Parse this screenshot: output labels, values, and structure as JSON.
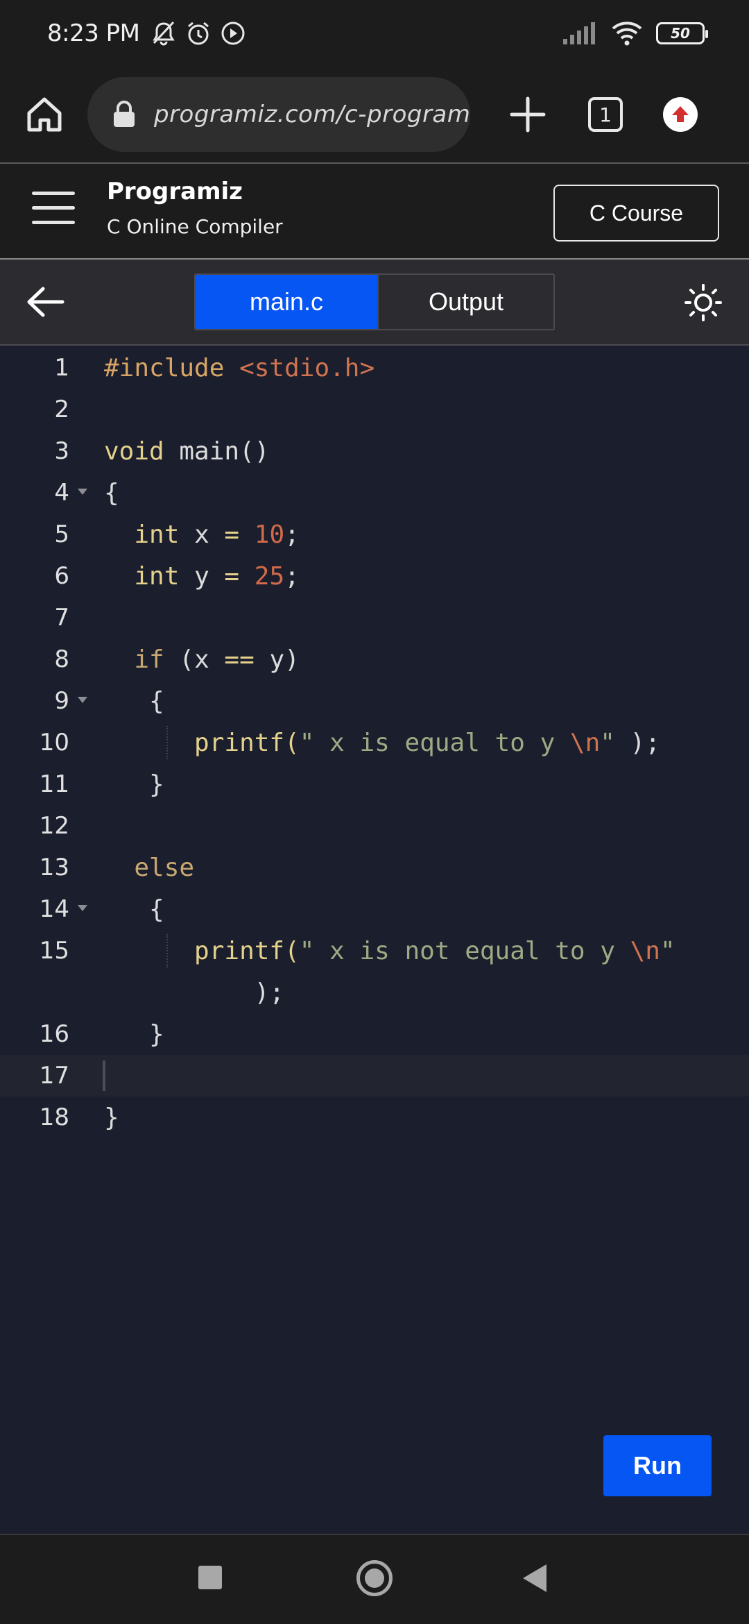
{
  "status_bar": {
    "time": "8:23 PM",
    "battery": "50",
    "icons": [
      "bell-off-icon",
      "alarm-icon",
      "play-circle-icon",
      "signal-icon",
      "wifi-icon",
      "battery-icon"
    ]
  },
  "browser": {
    "url": "programiz.com/c-programm",
    "tab_count": "1"
  },
  "site_header": {
    "brand": "Programiz",
    "subtitle": "C Online Compiler",
    "course_button": "C Course"
  },
  "editor_toolbar": {
    "tabs": [
      {
        "label": "main.c",
        "active": true
      },
      {
        "label": "Output",
        "active": false
      }
    ]
  },
  "code_lines": [
    {
      "no": "1",
      "text": "#include <stdio.h>"
    },
    {
      "no": "2",
      "text": ""
    },
    {
      "no": "3",
      "text": "void main()"
    },
    {
      "no": "4",
      "text": "{"
    },
    {
      "no": "5",
      "text": "  int x = 10;"
    },
    {
      "no": "6",
      "text": "  int y = 25;"
    },
    {
      "no": "7",
      "text": ""
    },
    {
      "no": "8",
      "text": "  if (x == y)"
    },
    {
      "no": "9",
      "text": "   {"
    },
    {
      "no": "10",
      "text": "      printf(\" x is equal to y \\n\" );"
    },
    {
      "no": "11",
      "text": "   }"
    },
    {
      "no": "12",
      "text": ""
    },
    {
      "no": "13",
      "text": "  else"
    },
    {
      "no": "14",
      "text": "   {"
    },
    {
      "no": "15",
      "text": "      printf(\" x is not equal to y \\n\""
    },
    {
      "no": "",
      "text": "          );"
    },
    {
      "no": "16",
      "text": "   }"
    },
    {
      "no": "17",
      "text": ""
    },
    {
      "no": "18",
      "text": "}"
    }
  ],
  "run_button": "Run"
}
